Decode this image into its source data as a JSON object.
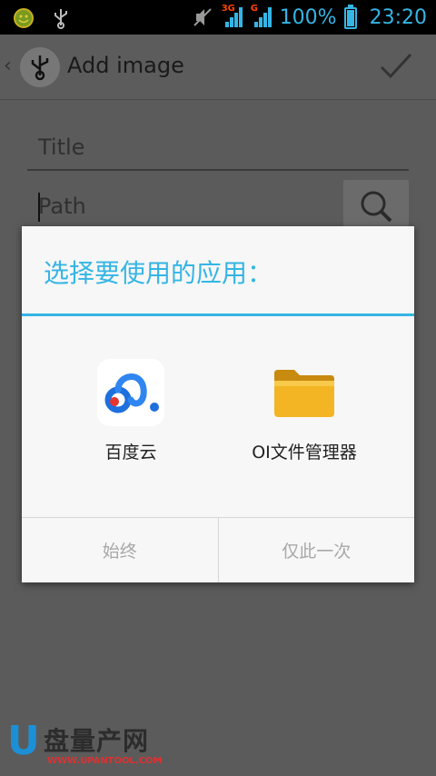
{
  "status_bar": {
    "icons": [
      "smiley-notification-icon",
      "usb-icon",
      "muted-icon",
      "signal-3g-icon",
      "signal-g-icon",
      "battery-icon"
    ],
    "network_1": "3G",
    "network_2": "G",
    "battery": "100%",
    "time": "23:20",
    "accent": "#35b5e5"
  },
  "action_bar": {
    "title": "Add image",
    "icons": [
      "up-chevron-icon",
      "usb-app-icon",
      "checkmark-icon"
    ]
  },
  "form": {
    "title_placeholder": "Title",
    "path_placeholder": "Path",
    "search_icon": "search-icon"
  },
  "dialog": {
    "title": "选择要使用的应用：",
    "apps": [
      {
        "label": "百度云",
        "icon": "baidu-cloud-icon"
      },
      {
        "label": "OI文件管理器",
        "icon": "folder-icon"
      }
    ],
    "buttons": {
      "always": "始终",
      "just_once": "仅此一次"
    }
  },
  "watermark": {
    "letter": "U",
    "name": "盘量产网",
    "url": "WWW.UPANTOOL.COM"
  }
}
